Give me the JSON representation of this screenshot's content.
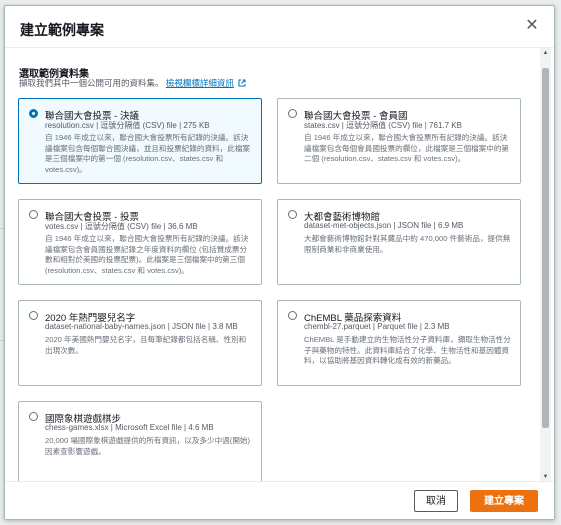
{
  "modal": {
    "title": "建立範例專案",
    "close_icon": "close-icon"
  },
  "section": {
    "title": "選取範例資料集",
    "desc": "擷取我們其中一個公開可用的資料集。",
    "link": "檢視欄標詳細資訊"
  },
  "datasets": [
    {
      "title": "聯合國大會投票 - 決議",
      "meta": "resolution.csv | 逗號分隔值 (CSV) file | 275 KB",
      "desc": "自 1946 年成立以來，聯合國大會投票所有記錄的決議。該決議檔案包含每個聯合國決議，並且和投票紀錄的資料，此檔案是三個檔案中的第一個 (resolution.csv、states.csv 和 votes.csv)。",
      "selected": true
    },
    {
      "title": "聯合國大會投票 - 會員國",
      "meta": "states.csv | 逗號分隔值 (CSV) file | 761.7 KB",
      "desc": "自 1946 年成立以來，聯合國大會投票所有記錄的決議。該決議檔案包含每個會員國投票的欄位，此檔案是三個檔案中的第二個 (resolution.csv、states.csv 和 votes.csv)。",
      "selected": false
    },
    {
      "title": "聯合國大會投票 - 投票",
      "meta": "votes.csv | 逗號分隔值 (CSV) file | 36.6 MB",
      "desc": "自 1946 年成立以來，聯合國大會投票所有記錄的決議。該決議檔案包含會員國投票記錄之年度資料的欄位 (包括贊成票分數和相對於美國的投票配票)。此檔案是三個檔案中的第三個 (resolution.csv、states.csv 和 votes.csv)。",
      "selected": false
    },
    {
      "title": "大都會藝術博物館",
      "meta": "dataset-met-objects.json | JSON file | 6.9 MB",
      "desc": "大都會藝術博物館針對其藏品中約 470,000 件藝術品，提供無限制商業和非商業使用。",
      "selected": false
    },
    {
      "title": "2020 年熱門嬰兒名字",
      "meta": "dataset-national-baby-names.json | JSON file | 3.8 MB",
      "desc": "2020 年美國熱門嬰兒名字，且每筆紀錄都包括名稱、性別和出現次數。",
      "selected": false
    },
    {
      "title": "ChEMBL 藥品探索資料",
      "meta": "chembl-27.parquet | Parquet file | 2.3 MB",
      "desc": "ChEMBL 是手動建立的生物活性分子資料庫，擷取生物活性分子與藥物的特性。此資料庫結合了化學、生物活性和基因體資料，以協助將基因資料轉化成有效的新藥品。",
      "selected": false
    },
    {
      "title": "國際象棋遊戲棋步",
      "meta": "chess-games.xlsx | Microsoft Excel file | 4.6 MB",
      "desc": "20,000 場國際象棋遊戲提供的所有資訊，以及多少中週(開始)因素查影響遊戲。",
      "selected": false
    }
  ],
  "footer": {
    "cancel": "取消",
    "create": "建立專案"
  }
}
